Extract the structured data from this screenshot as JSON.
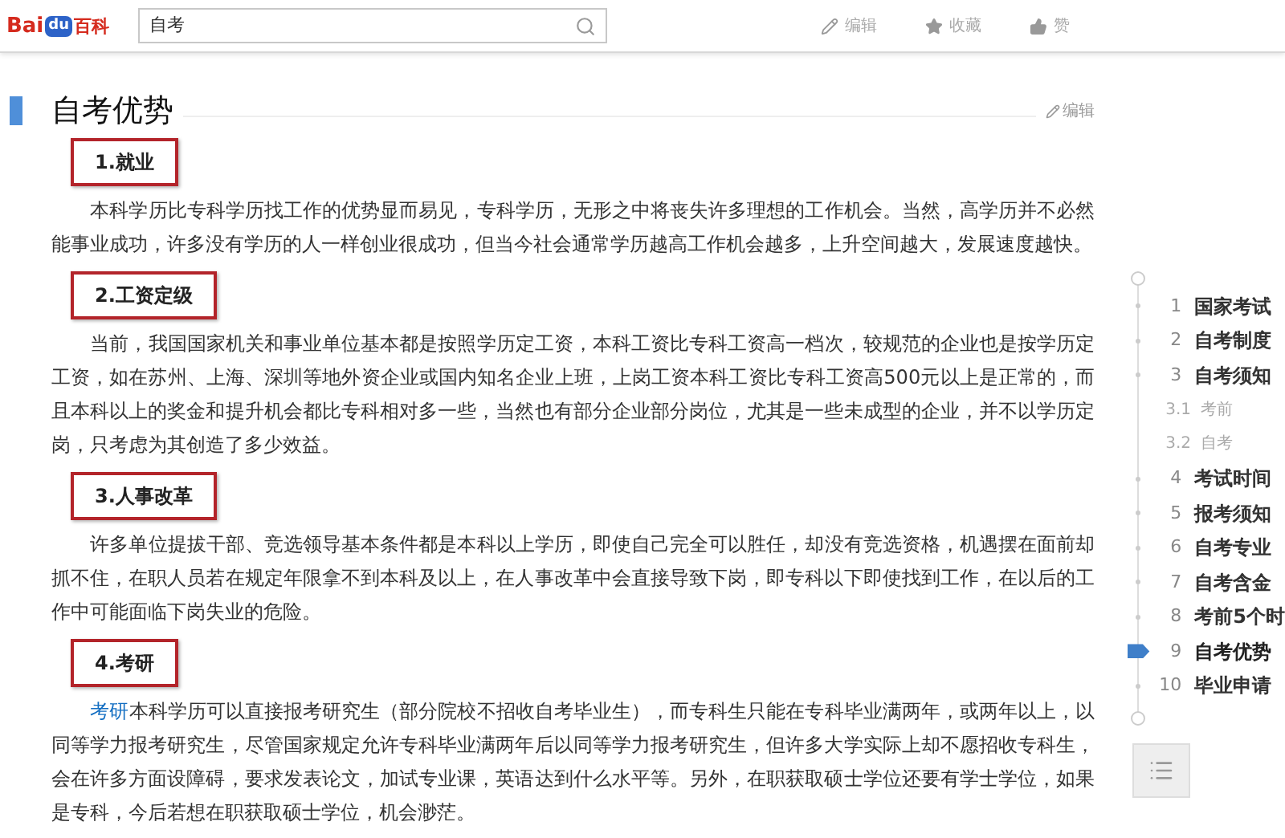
{
  "header": {
    "logo": {
      "left": "Bai",
      "middle": "du",
      "right": "百科"
    },
    "search": {
      "value": "自考"
    },
    "actions": [
      {
        "kind": "edit",
        "label": "编辑"
      },
      {
        "kind": "favorite",
        "label": "收藏"
      },
      {
        "kind": "like",
        "label": "赞"
      }
    ]
  },
  "article": {
    "title": "自考优势",
    "edit_label": "编辑",
    "sections": [
      {
        "heading": "1.就业",
        "paragraphs": [
          "本科学历比专科学历找工作的优势显而易见，专科学历，无形之中将丧失许多理想的工作机会。当然，高学历并不必然能事业成功，许多没有学历的人一样创业很成功，但当今社会通常学历越高工作机会越多，上升空间越大，发展速度越快。"
        ]
      },
      {
        "heading": "2.工资定级",
        "paragraphs": [
          "当前，我国国家机关和事业单位基本都是按照学历定工资，本科工资比专科工资高一档次，较规范的企业也是按学历定工资，如在苏州、上海、深圳等地外资企业或国内知名企业上班，上岗工资本科工资比专科工资高500元以上是正常的，而且本科以上的奖金和提升机会都比专科相对多一些，当然也有部分企业部分岗位，尤其是一些未成型的企业，并不以学历定岗，只考虑为其创造了多少效益。"
        ]
      },
      {
        "heading": "3.人事改革",
        "paragraphs": [
          "许多单位提拔干部、竞选领导基本条件都是本科以上学历，即使自己完全可以胜任，却没有竞选资格，机遇摆在面前却抓不住，在职人员若在规定年限拿不到本科及以上，在人事改革中会直接导致下岗，即专科以下即使找到工作，在以后的工作中可能面临下岗失业的危险。"
        ]
      },
      {
        "heading": "4.考研",
        "link": "考研",
        "paragraphs": [
          "本科学历可以直接报考研究生（部分院校不招收自考毕业生），而专科生只能在专科毕业满两年，或两年以上，以同等学力报考研究生，尽管国家规定允许专科毕业满两年后以同等学力报考研究生，但许多大学实际上却不愿招收专科生，会在许多方面设障碍，要求发表论文，加试专业课，英语达到什么水平等。另外，在职获取硕士学位还要有学士学位，如果是专科，今后若想在职获取硕士学位，机会渺茫。"
        ]
      }
    ]
  },
  "toc": {
    "items": [
      {
        "number": "1",
        "label": "国家考试",
        "selected": false
      },
      {
        "number": "2",
        "label": "自考制度",
        "selected": false
      },
      {
        "number": "3",
        "label": "自考须知",
        "selected": false,
        "children": [
          {
            "number": "3.1",
            "label": "考前"
          },
          {
            "number": "3.2",
            "label": "自考"
          }
        ]
      },
      {
        "number": "4",
        "label": "考试时间",
        "selected": false
      },
      {
        "number": "5",
        "label": "报考须知",
        "selected": false
      },
      {
        "number": "6",
        "label": "自考专业",
        "selected": false
      },
      {
        "number": "7",
        "label": "自考含金",
        "selected": false
      },
      {
        "number": "8",
        "label": "考前5个时",
        "selected": false
      },
      {
        "number": "9",
        "label": "自考优势",
        "selected": true
      },
      {
        "number": "10",
        "label": "毕业申请",
        "selected": false
      }
    ]
  }
}
